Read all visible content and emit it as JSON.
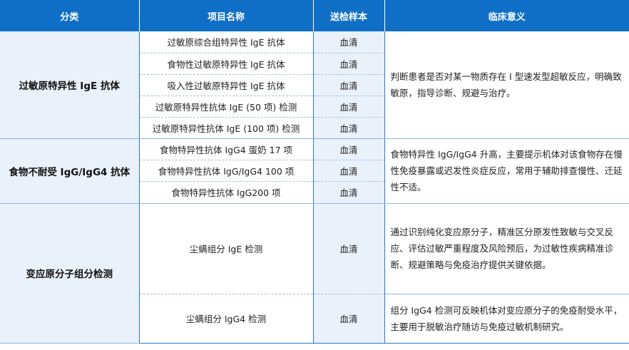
{
  "header": [
    "分类",
    "项目名称",
    "送检样本",
    "临床意义"
  ],
  "groups": [
    {
      "category": "过敏原特异性 IgE 抗体",
      "meaning": "判断患者是否对某一物质存在 I 型速发型超敏反应，明确致敏原，指导诊断、规避与治疗。",
      "items": [
        {
          "name": "过敏原综合组特异性 IgE 抗体",
          "sample": "血清"
        },
        {
          "name": "食物性过敏原特异性 IgE 抗体",
          "sample": "血清"
        },
        {
          "name": "吸入性过敏原特异性 IgE 抗体",
          "sample": "血清"
        },
        {
          "name": "过敏原特异性抗体 IgE (50 项) 检测",
          "sample": "血清"
        },
        {
          "name": "过敏原特异性抗体 IgE (100 项) 检测",
          "sample": "血清"
        }
      ]
    },
    {
      "category": "食物不耐受 IgG/IgG4 抗体",
      "meaning": "食物特异性 IgG/IgG4 升高，主要提示机体对该食物存在慢性免疫暴露或迟发性炎症反应，常用于辅助排查慢性、迁延性不适。",
      "items": [
        {
          "name": "食物特异性抗体 IgG4 蛋奶 17 项",
          "sample": "血清"
        },
        {
          "name": "食物特异性抗体 IgG/IgG4 100 项",
          "sample": "血清"
        },
        {
          "name": "食物特异性抗体 IgG200 项",
          "sample": "血清"
        }
      ]
    },
    {
      "category": "变应原分子组分检测",
      "items": [
        {
          "name": "尘螨组分 IgE 检测",
          "sample": "血清",
          "meaning": "通过识别纯化变应原分子，精准区分原发性致敏与交叉反应、评估过敏严重程度及风险预后，为过敏性疾病精准诊断、规避策略与免疫治疗提供关键依据。"
        },
        {
          "name": "尘螨组分 IgG4 检测",
          "sample": "血清",
          "meaning": "组分 IgG4 检测可反映机体对变应原分子的免疫耐受水平，主要用于脱敏治疗随访与免疫过敏机制研究。"
        }
      ]
    }
  ]
}
